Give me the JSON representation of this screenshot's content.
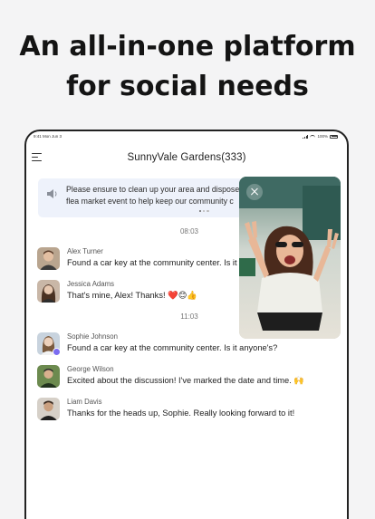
{
  "headline": {
    "line1": "An all-in-one platform",
    "line2": "for social needs"
  },
  "status_bar": {
    "time": "9:41 Mon Jun 3",
    "battery": "100%"
  },
  "chat": {
    "title": "SunnyVale Gardens(333)",
    "notice": {
      "line1": "Please ensure to clean up your area and dispose",
      "line2": "flea market event to help keep our community c",
      "page_indicator": {
        "count": 3,
        "active": 0
      }
    },
    "groups": [
      {
        "time": "08:03",
        "messages": [
          {
            "sender": "Alex Turner",
            "text": "Found a car key at the community center. Is it"
          },
          {
            "sender": "Jessica Adams",
            "text": "That's mine, Alex! Thanks! ❤️😊👍"
          }
        ]
      },
      {
        "time": "11:03",
        "messages": [
          {
            "sender": "Sophie Johnson",
            "text": "Found a car key at the community center. Is it anyone's?"
          },
          {
            "sender": "George Wilson",
            "text": "Excited about the discussion! I've marked the date and time. 🙌"
          },
          {
            "sender": "Liam Davis",
            "text": "Thanks for the heads up, Sophie. Really looking forward to it!"
          }
        ]
      }
    ]
  },
  "icons": {
    "menu": "menu-icon",
    "notice": "speaker-icon",
    "close": "close-icon",
    "verified_badge": "badge-icon"
  },
  "colors": {
    "notice_background": "#eef2fb",
    "badge": "#7b6cf0"
  }
}
